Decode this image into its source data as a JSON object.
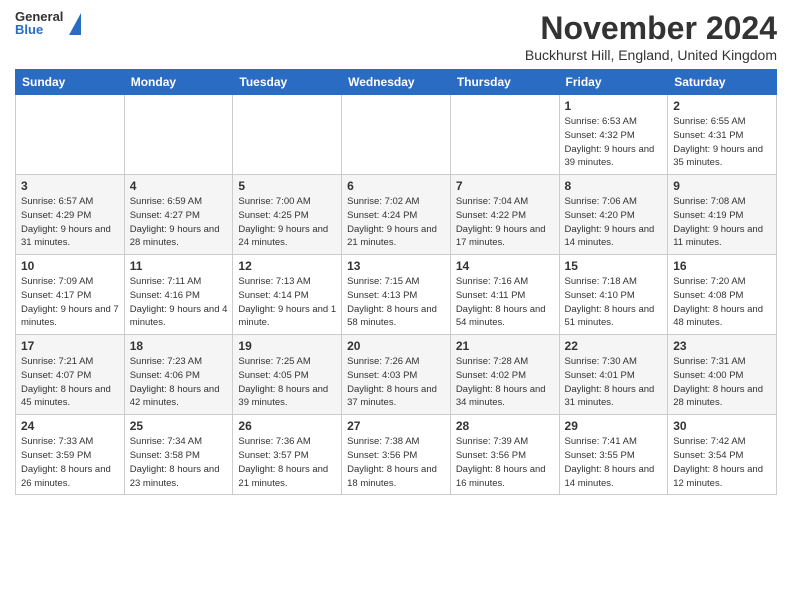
{
  "header": {
    "logo_general": "General",
    "logo_blue": "Blue",
    "month_title": "November 2024",
    "location": "Buckhurst Hill, England, United Kingdom"
  },
  "days_of_week": [
    "Sunday",
    "Monday",
    "Tuesday",
    "Wednesday",
    "Thursday",
    "Friday",
    "Saturday"
  ],
  "weeks": [
    [
      {
        "day": "",
        "info": ""
      },
      {
        "day": "",
        "info": ""
      },
      {
        "day": "",
        "info": ""
      },
      {
        "day": "",
        "info": ""
      },
      {
        "day": "",
        "info": ""
      },
      {
        "day": "1",
        "info": "Sunrise: 6:53 AM\nSunset: 4:32 PM\nDaylight: 9 hours and 39 minutes."
      },
      {
        "day": "2",
        "info": "Sunrise: 6:55 AM\nSunset: 4:31 PM\nDaylight: 9 hours and 35 minutes."
      }
    ],
    [
      {
        "day": "3",
        "info": "Sunrise: 6:57 AM\nSunset: 4:29 PM\nDaylight: 9 hours and 31 minutes."
      },
      {
        "day": "4",
        "info": "Sunrise: 6:59 AM\nSunset: 4:27 PM\nDaylight: 9 hours and 28 minutes."
      },
      {
        "day": "5",
        "info": "Sunrise: 7:00 AM\nSunset: 4:25 PM\nDaylight: 9 hours and 24 minutes."
      },
      {
        "day": "6",
        "info": "Sunrise: 7:02 AM\nSunset: 4:24 PM\nDaylight: 9 hours and 21 minutes."
      },
      {
        "day": "7",
        "info": "Sunrise: 7:04 AM\nSunset: 4:22 PM\nDaylight: 9 hours and 17 minutes."
      },
      {
        "day": "8",
        "info": "Sunrise: 7:06 AM\nSunset: 4:20 PM\nDaylight: 9 hours and 14 minutes."
      },
      {
        "day": "9",
        "info": "Sunrise: 7:08 AM\nSunset: 4:19 PM\nDaylight: 9 hours and 11 minutes."
      }
    ],
    [
      {
        "day": "10",
        "info": "Sunrise: 7:09 AM\nSunset: 4:17 PM\nDaylight: 9 hours and 7 minutes."
      },
      {
        "day": "11",
        "info": "Sunrise: 7:11 AM\nSunset: 4:16 PM\nDaylight: 9 hours and 4 minutes."
      },
      {
        "day": "12",
        "info": "Sunrise: 7:13 AM\nSunset: 4:14 PM\nDaylight: 9 hours and 1 minute."
      },
      {
        "day": "13",
        "info": "Sunrise: 7:15 AM\nSunset: 4:13 PM\nDaylight: 8 hours and 58 minutes."
      },
      {
        "day": "14",
        "info": "Sunrise: 7:16 AM\nSunset: 4:11 PM\nDaylight: 8 hours and 54 minutes."
      },
      {
        "day": "15",
        "info": "Sunrise: 7:18 AM\nSunset: 4:10 PM\nDaylight: 8 hours and 51 minutes."
      },
      {
        "day": "16",
        "info": "Sunrise: 7:20 AM\nSunset: 4:08 PM\nDaylight: 8 hours and 48 minutes."
      }
    ],
    [
      {
        "day": "17",
        "info": "Sunrise: 7:21 AM\nSunset: 4:07 PM\nDaylight: 8 hours and 45 minutes."
      },
      {
        "day": "18",
        "info": "Sunrise: 7:23 AM\nSunset: 4:06 PM\nDaylight: 8 hours and 42 minutes."
      },
      {
        "day": "19",
        "info": "Sunrise: 7:25 AM\nSunset: 4:05 PM\nDaylight: 8 hours and 39 minutes."
      },
      {
        "day": "20",
        "info": "Sunrise: 7:26 AM\nSunset: 4:03 PM\nDaylight: 8 hours and 37 minutes."
      },
      {
        "day": "21",
        "info": "Sunrise: 7:28 AM\nSunset: 4:02 PM\nDaylight: 8 hours and 34 minutes."
      },
      {
        "day": "22",
        "info": "Sunrise: 7:30 AM\nSunset: 4:01 PM\nDaylight: 8 hours and 31 minutes."
      },
      {
        "day": "23",
        "info": "Sunrise: 7:31 AM\nSunset: 4:00 PM\nDaylight: 8 hours and 28 minutes."
      }
    ],
    [
      {
        "day": "24",
        "info": "Sunrise: 7:33 AM\nSunset: 3:59 PM\nDaylight: 8 hours and 26 minutes."
      },
      {
        "day": "25",
        "info": "Sunrise: 7:34 AM\nSunset: 3:58 PM\nDaylight: 8 hours and 23 minutes."
      },
      {
        "day": "26",
        "info": "Sunrise: 7:36 AM\nSunset: 3:57 PM\nDaylight: 8 hours and 21 minutes."
      },
      {
        "day": "27",
        "info": "Sunrise: 7:38 AM\nSunset: 3:56 PM\nDaylight: 8 hours and 18 minutes."
      },
      {
        "day": "28",
        "info": "Sunrise: 7:39 AM\nSunset: 3:56 PM\nDaylight: 8 hours and 16 minutes."
      },
      {
        "day": "29",
        "info": "Sunrise: 7:41 AM\nSunset: 3:55 PM\nDaylight: 8 hours and 14 minutes."
      },
      {
        "day": "30",
        "info": "Sunrise: 7:42 AM\nSunset: 3:54 PM\nDaylight: 8 hours and 12 minutes."
      }
    ]
  ]
}
